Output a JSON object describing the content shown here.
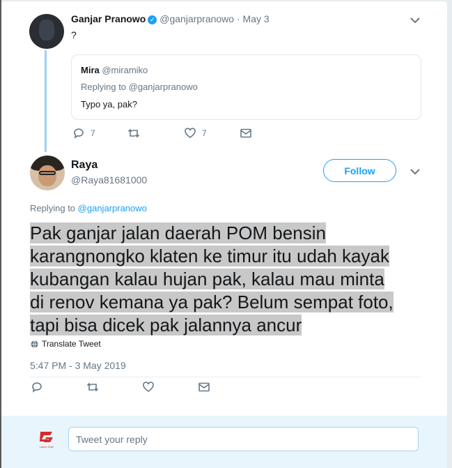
{
  "parent_tweet": {
    "display_name": "Ganjar Pranowo",
    "handle": "@ganjarpranowo",
    "date": "· May 3",
    "text": "?",
    "quoted": {
      "display_name": "Mira",
      "handle": "@miramiko",
      "replying_to": "Replying to @ganjarpranowo",
      "text": "Typo ya, pak?"
    },
    "reply_count": "7",
    "like_count": "7"
  },
  "main_tweet": {
    "display_name": "Raya",
    "handle": "@Raya81681000",
    "follow_label": "Follow",
    "replying_prefix": "Replying to",
    "replying_handle": "@ganjarpranowo",
    "text_lines": [
      "Pak ganjar jalan daerah POM bensin ",
      "karangnongko klaten ke timur itu udah kayak ",
      "kubangan kalau hujan pak, kalau mau minta ",
      "di renov kemana ya pak? Belum sempat foto, ",
      "tapi bisa dicek pak jalannya ancur"
    ],
    "translate_label": "Translate Tweet",
    "timestamp": "5:47 PM - 3 May 2019"
  },
  "reply_box": {
    "placeholder": "Tweet your reply",
    "logo_text": "Lapor Gub!"
  },
  "colors": {
    "accent": "#1da1f2",
    "muted": "#657786",
    "highlight": "#c8c8c8",
    "reply_bar": "#e8f5fd"
  }
}
